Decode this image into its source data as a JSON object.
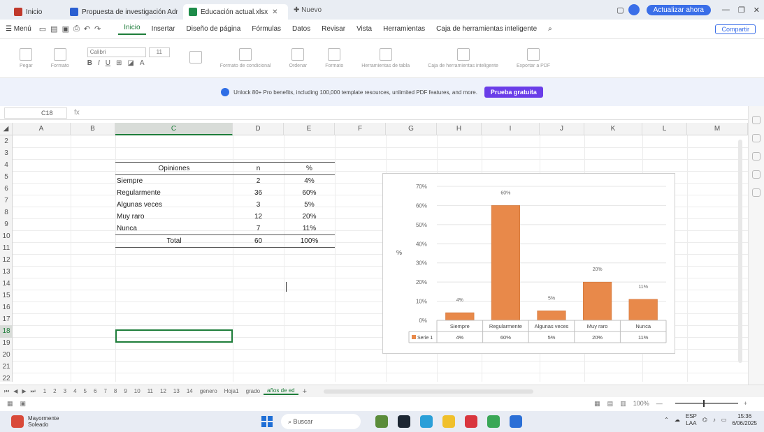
{
  "titlebar": {
    "tabs": [
      {
        "label": "Inicio",
        "color": "#c0392b",
        "active": false
      },
      {
        "label": "Propuesta de investigación Adrian...",
        "color": "#2a5fd1",
        "active": false
      },
      {
        "label": "Educación actual.xlsx",
        "color": "#1e8c4a",
        "active": true
      }
    ],
    "new_tab_label": "Nuevo",
    "upgrade_label": "Actualizar ahora"
  },
  "menubar": {
    "menu_label": "Menú",
    "items": [
      "Inicio",
      "Insertar",
      "Diseño de página",
      "Fórmulas",
      "Datos",
      "Revisar",
      "Vista",
      "Herramientas",
      "Caja de herramientas inteligente"
    ],
    "share_label": "Compartir"
  },
  "ribbon": {
    "font_name": "Calibri",
    "font_size": "11",
    "groups": [
      "Pegar",
      "Formato",
      "Formato de condicional",
      "Ordenar",
      "Formato",
      "Herramientas de tabla",
      "Caja de herramientas inteligente",
      "Exportar a PDF"
    ]
  },
  "promo": {
    "text": "Unlock 80+ Pro benefits, including 100,000 template resources, unlimited PDF features, and more.",
    "button_label": "Prueba gratuita"
  },
  "formula_bar": {
    "cell_ref": "C18",
    "fx": "fx"
  },
  "columns": [
    "A",
    "B",
    "C",
    "D",
    "E",
    "F",
    "G",
    "H",
    "I",
    "J",
    "K",
    "L",
    "M"
  ],
  "rows": [
    "2",
    "3",
    "4",
    "5",
    "6",
    "7",
    "8",
    "9",
    "10",
    "11",
    "12",
    "13",
    "14",
    "15",
    "16",
    "17",
    "18",
    "19",
    "20",
    "21",
    "22"
  ],
  "table": {
    "headers": [
      "Opiniones",
      "n",
      "%"
    ],
    "rows": [
      [
        "Siempre",
        "2",
        "4%"
      ],
      [
        "Regularmente",
        "36",
        "60%"
      ],
      [
        "Algunas veces",
        "3",
        "5%"
      ],
      [
        "Muy raro",
        "12",
        "20%"
      ],
      [
        "Nunca",
        "7",
        "11%"
      ]
    ],
    "total": [
      "Total",
      "60",
      "100%"
    ]
  },
  "chart_data": {
    "type": "bar",
    "categories": [
      "Siempre",
      "Regularmente",
      "Algunas veces",
      "Muy raro",
      "Nunca"
    ],
    "series": [
      {
        "name": "Serie 1",
        "values": [
          4,
          60,
          5,
          20,
          11
        ],
        "labels": [
          "4%",
          "60%",
          "5%",
          "20%",
          "11%"
        ],
        "color": "#e8894a"
      }
    ],
    "y_ticks": [
      "0%",
      "10%",
      "20%",
      "30%",
      "40%",
      "50%",
      "60%",
      "70%"
    ],
    "ylim": [
      0,
      70
    ],
    "ylabel": "%",
    "data_table": true,
    "grid": true
  },
  "sheet_tabs": [
    "1",
    "2",
    "3",
    "4",
    "5",
    "6",
    "7",
    "8",
    "9",
    "10",
    "11",
    "12",
    "13",
    "14",
    "genero",
    "Hoja1",
    "grado",
    "años de ed"
  ],
  "statusbar": {
    "zoom": "100%"
  },
  "taskbar": {
    "weather_line1": "Mayormente",
    "weather_line2": "Soleado",
    "search_placeholder": "Buscar",
    "tray_lang_1": "ESP",
    "tray_lang_2": "LAA",
    "time": "15:36",
    "date": "6/06/2025"
  }
}
